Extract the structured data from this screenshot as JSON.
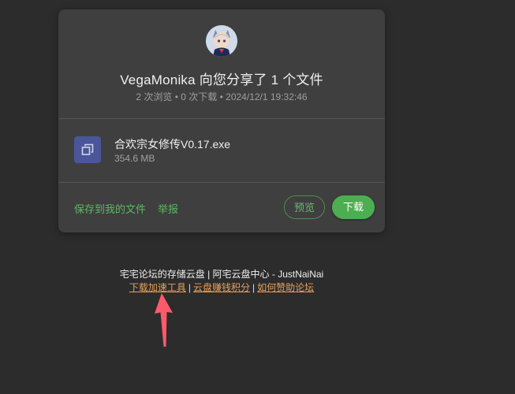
{
  "share": {
    "title": "VegaMonika 向您分享了 1 个文件",
    "meta": "2 次浏览 • 0 次下载 • 2024/12/1 19:32:46"
  },
  "file": {
    "name": "合欢宗女修传V0.17.exe",
    "size": "354.6 MB",
    "icon": "copy-icon"
  },
  "actions": {
    "save_label": "保存到我的文件",
    "report_label": "举报",
    "preview_label": "预览",
    "download_label": "下载"
  },
  "footer": {
    "line1": "宅宅论坛的存储云盘 | 阿宅云盘中心 - JustNaiNai",
    "links": [
      "下载加速工具",
      "云盘赚钱积分",
      "如何赞助论坛"
    ],
    "separator": "|"
  },
  "colors": {
    "background": "#2c2c2c",
    "card": "#3f3f3f",
    "accent_green": "#4cae50",
    "link_orange": "#e8a05a",
    "annotation_arrow": "#ff5a6a",
    "file_icon_bg": "#4a5699"
  }
}
